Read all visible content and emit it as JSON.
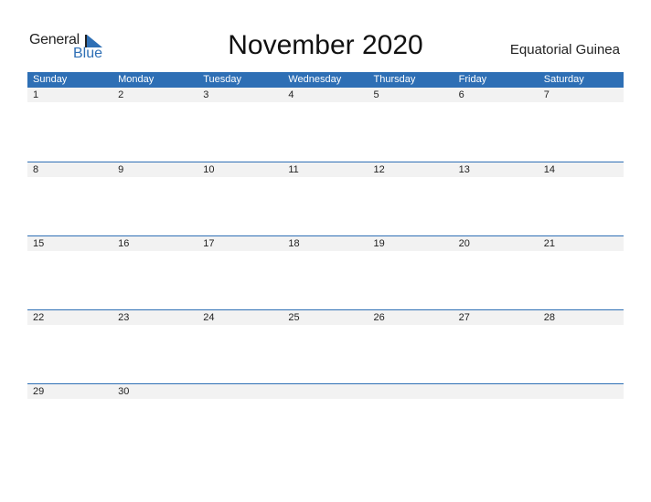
{
  "logo": {
    "line1": "General",
    "line2": "Blue"
  },
  "title": "November 2020",
  "country": "Equatorial Guinea",
  "colors": {
    "accent": "#2e6fb5",
    "row_bg": "#f2f2f2"
  },
  "weekdays": [
    "Sunday",
    "Monday",
    "Tuesday",
    "Wednesday",
    "Thursday",
    "Friday",
    "Saturday"
  ],
  "weeks": [
    [
      "1",
      "2",
      "3",
      "4",
      "5",
      "6",
      "7"
    ],
    [
      "8",
      "9",
      "10",
      "11",
      "12",
      "13",
      "14"
    ],
    [
      "15",
      "16",
      "17",
      "18",
      "19",
      "20",
      "21"
    ],
    [
      "22",
      "23",
      "24",
      "25",
      "26",
      "27",
      "28"
    ],
    [
      "29",
      "30",
      "",
      "",
      "",
      "",
      ""
    ]
  ]
}
